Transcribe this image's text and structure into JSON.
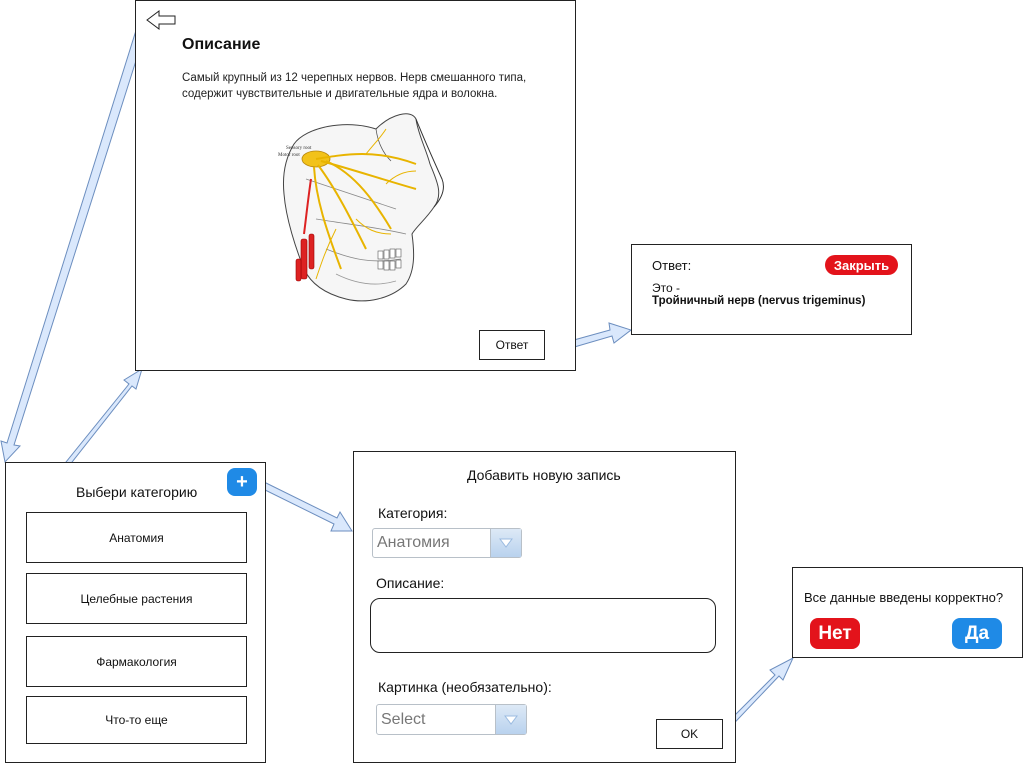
{
  "description_card": {
    "title": "Описание",
    "text_line1": "Самый крупный из 12 черепных нервов. Нерв смешанного типа,",
    "text_line2": "содержит чувствительные и двигательные ядра и волокна.",
    "image_label_1": "Sensory root",
    "image_label_2": "Motor root",
    "answer_button": "Ответ",
    "back_icon": "arrow-left-icon"
  },
  "answer_card": {
    "label": "Ответ:",
    "close_button": "Закрыть",
    "prefix": "Это -",
    "answer": "Тройничный нерв (nervus trigeminus)",
    "close_color": "#e3131b"
  },
  "category_card": {
    "title": "Выбери категорию",
    "add_icon": "plus-icon",
    "items": [
      {
        "label": "Анатомия"
      },
      {
        "label": "Целебные растения"
      },
      {
        "label": "Фармакология"
      },
      {
        "label": "Что-то еще"
      }
    ]
  },
  "add_card": {
    "title": "Добавить новую запись",
    "category_label": "Категория:",
    "category_value": "Анатомия",
    "description_label": "Описание:",
    "description_value": "",
    "picture_label": "Картинка (необязательно):",
    "picture_value": "Select",
    "ok_button": "OK"
  },
  "confirm_card": {
    "question": "Все данные введены корректно?",
    "no_button": "Нет",
    "yes_button": "Да",
    "no_color": "#e3131b",
    "yes_color": "#1f8ae6"
  },
  "colors": {
    "arrow_fill": "#dae8fc",
    "arrow_stroke": "#6c8ebf",
    "add_button": "#1f8ae6"
  }
}
